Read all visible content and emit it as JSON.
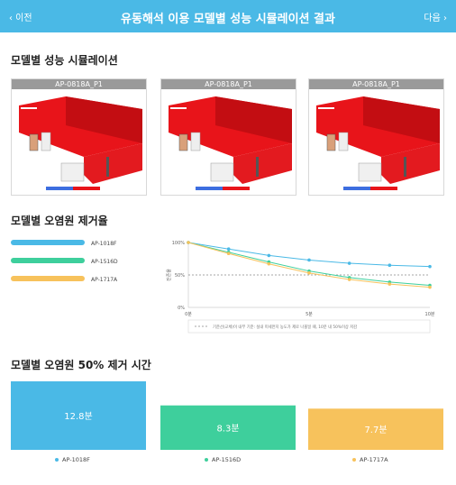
{
  "header": {
    "back_label": "‹ 이전",
    "title": "유동해석 이용 모델별 성능 시뮬레이션 결과",
    "next_label": "다음 ›",
    "background": "#4ab9e6"
  },
  "simulation": {
    "section_title": "모델별 성능 시뮬레이션",
    "panels": [
      {
        "label": "AP-0818A_P1"
      },
      {
        "label": "AP-0818A_P1"
      },
      {
        "label": "AP-0818A_P1"
      }
    ]
  },
  "removal_rate": {
    "section_title": "모델별 오염원 제거율",
    "legend": [
      {
        "name": "AP-1018F",
        "color": "#4ab9e6"
      },
      {
        "name": "AP-1516D",
        "color": "#3ecf9c"
      },
      {
        "name": "AP-1717A",
        "color": "#f7c25c"
      }
    ],
    "footnote": "기준선(교체)이 내부 기준: 실내 미세먼지 농도가 제로 나올일 때, 10분 내 50%이상 저감"
  },
  "removal_time": {
    "section_title": "모델별 오염원 50% 제거 시간"
  },
  "chart_data": [
    {
      "type": "line",
      "x": [
        0,
        1,
        2,
        3,
        4,
        5,
        6
      ],
      "xticks": [
        "0분",
        "5분",
        "10분"
      ],
      "yticks": [
        "100%",
        "50%",
        "0%"
      ],
      "ylabel": "잔존율",
      "ylim": [
        0,
        100
      ],
      "baseline": 50,
      "series": [
        {
          "name": "AP-1018F",
          "color": "#4ab9e6",
          "values": [
            100,
            90,
            80,
            73,
            68,
            65,
            63
          ]
        },
        {
          "name": "AP-1516D",
          "color": "#3ecf9c",
          "values": [
            100,
            85,
            70,
            56,
            46,
            39,
            34
          ]
        },
        {
          "name": "AP-1717A",
          "color": "#f7c25c",
          "values": [
            100,
            83,
            67,
            53,
            43,
            36,
            31
          ]
        }
      ]
    },
    {
      "type": "bar",
      "title": "모델별 오염원 50% 제거 시간",
      "categories": [
        "AP-1018F",
        "AP-1516D",
        "AP-1717A"
      ],
      "values": [
        12.8,
        8.3,
        7.7
      ],
      "value_labels": [
        "12.8분",
        "8.3분",
        "7.7분"
      ],
      "colors": [
        "#4ab9e6",
        "#3ecf9c",
        "#f7c25c"
      ],
      "ylim": [
        0,
        12.8
      ]
    }
  ]
}
